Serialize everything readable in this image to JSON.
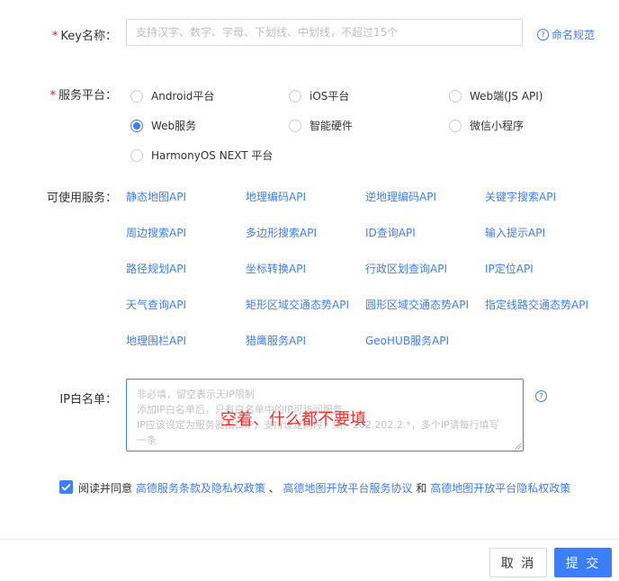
{
  "form": {
    "key_name": {
      "required_mark": "*",
      "label": "Key名称：",
      "placeholder": "支持汉字、数字、字母、下划线、中划线，不超过15个",
      "value": "",
      "help_link": "命名规范"
    },
    "platform": {
      "required_mark": "*",
      "label": "服务平台：",
      "options": [
        {
          "label": "Android平台",
          "checked": false
        },
        {
          "label": "iOS平台",
          "checked": false
        },
        {
          "label": "Web端(JS API)",
          "checked": false
        },
        {
          "label": "Web服务",
          "checked": true
        },
        {
          "label": "智能硬件",
          "checked": false
        },
        {
          "label": "微信小程序",
          "checked": false
        },
        {
          "label": "HarmonyOS NEXT 平台",
          "checked": false
        }
      ]
    },
    "apis": {
      "label": "可使用服务：",
      "items": [
        "静态地图API",
        "地理编码API",
        "逆地理编码API",
        "关键字搜索API",
        "周边搜索API",
        "多边形搜索API",
        "ID查询API",
        "输入提示API",
        "路径规划API",
        "坐标转换API",
        "行政区划查询API",
        "IP定位API",
        "天气查询API",
        "矩形区域交通态势API",
        "圆形区域交通态势API",
        "指定线路交通态势API",
        "地理围栏API",
        "猎鹰服务API",
        "GeoHUB服务API"
      ]
    },
    "ip_whitelist": {
      "label": "IP白名单：",
      "placeholder_lines": [
        "非必填，留空表示无IP限制",
        "添加IP白名单后，只有白名单中的IP可访问服务",
        "IP应该设定为服务器出口IP，支持设定网段，如：202.202.2.*，多个IP请每行填写",
        "一条"
      ],
      "annotation": "空着、什么都不要填"
    },
    "agreement": {
      "checked": true,
      "prefix": "阅读并同意",
      "link1": "高德服务条款及隐私权政策",
      "sep1": "、",
      "link2": "高德地图开放平台服务协议",
      "sep2": "和",
      "link3": "高德地图开放平台隐私权政策"
    }
  },
  "footer": {
    "cancel_label": "取 消",
    "submit_label": "提 交"
  },
  "colors": {
    "accent": "#3d7eff",
    "required": "#e02020",
    "annotation": "#ff2a2a"
  }
}
